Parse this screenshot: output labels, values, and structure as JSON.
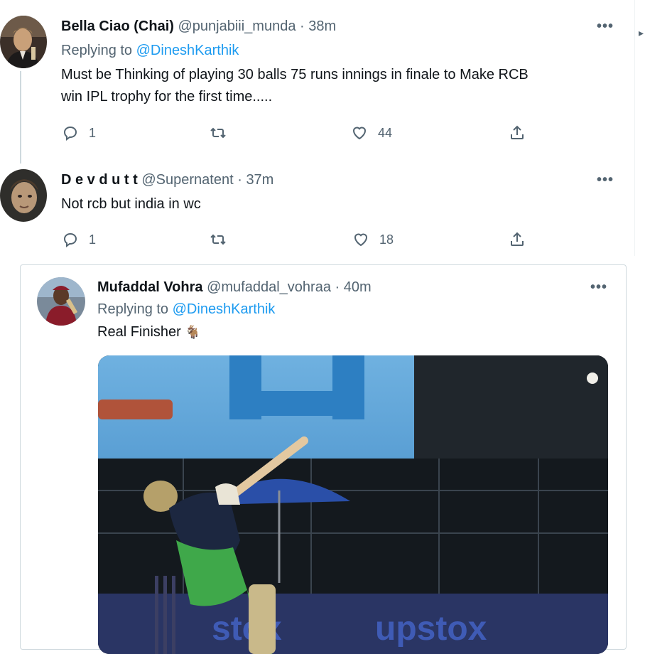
{
  "tweets": [
    {
      "display_name": "Bella Ciao (Chai)",
      "handle": "@punjabiii_munda",
      "separator": "·",
      "time": "38m",
      "replying_prefix": "Replying to",
      "replying_to": "@DineshKarthik",
      "text_line1": "Must be Thinking of playing 30 balls 75 runs innings in finale to Make RCB",
      "text_line2": "win IPL trophy for the first time.....",
      "replies": "1",
      "retweets": "",
      "likes": "44"
    },
    {
      "display_name": "D e v d u t t",
      "handle": "@Supernatent",
      "separator": "·",
      "time": "37m",
      "text_line1": "Not rcb but india in wc",
      "replies": "1",
      "retweets": "",
      "likes": "18"
    },
    {
      "display_name": "Mufaddal Vohra",
      "handle": "@mufaddal_vohraa",
      "separator": "·",
      "time": "40m",
      "replying_prefix": "Replying to",
      "replying_to": "@DineshKarthik",
      "text_line1": "Real Finisher",
      "emoji": "🐐"
    }
  ],
  "more_glyph": "•••",
  "media": {
    "banner_text": "upstox",
    "banner_text_left": "stox"
  },
  "icons": [
    "reply-icon",
    "retweet-icon",
    "like-icon",
    "share-icon",
    "more-icon"
  ],
  "colors": {
    "accent": "#1d9bf0",
    "muted": "#536471",
    "text": "#0f1419",
    "border": "#cfd9de"
  }
}
